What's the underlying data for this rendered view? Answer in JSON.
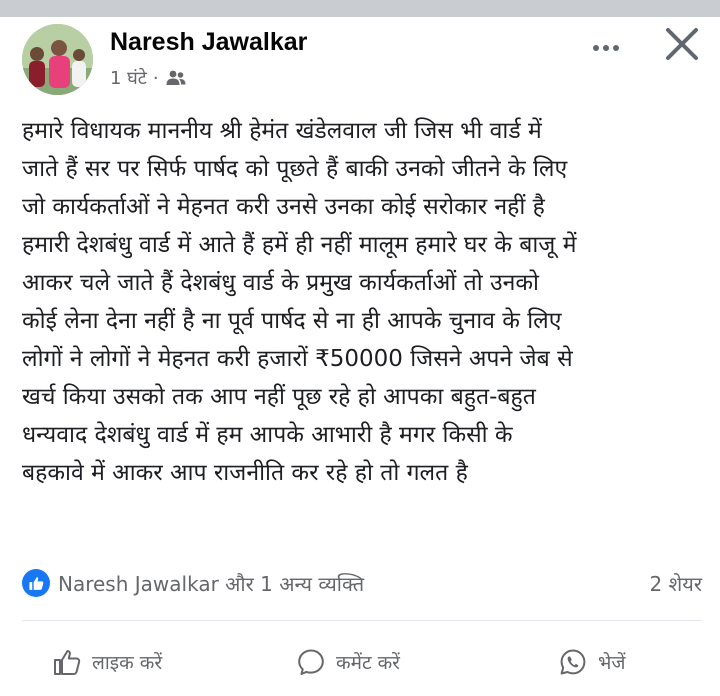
{
  "post": {
    "author": "Naresh Jawalkar",
    "time": "1 घंटे",
    "separator": "·",
    "audience_icon": "friends-icon",
    "more_icon": "more-options-icon",
    "close_icon": "close-icon",
    "lines": [
      "हमारे विधायक माननीय श्री हेमंत खंडेलवाल जी जिस भी वार्ड में",
      "जाते हैं सर पर सिर्फ पार्षद को पूछते हैं बाकी उनको जीतने के लिए",
      "जो कार्यकर्ताओं ने मेहनत करी उनसे उनका कोई सरोकार नहीं है",
      "हमारी देशबंधु वार्ड में आते हैं हमें ही नहीं मालूम हमारे घर के बाजू में",
      "आकर चले जाते हैं देशबंधु वार्ड के प्रमुख कार्यकर्ताओं तो उनको",
      "कोई लेना देना नहीं है ना पूर्व पार्षद से ना ही आपके चुनाव के लिए",
      "लोगों ने लोगों ने मेहनत करी हजारों ₹50000 जिसने अपने जेब से",
      "खर्च किया उसको तक आप नहीं पूछ रहे हो आपका बहुत-बहुत",
      "धन्यवाद देशबंधु वार्ड में हम आपके आभारी है मगर किसी के",
      "बहकावे में आकर आप राजनीति कर रहे हो तो गलत है"
    ]
  },
  "stats": {
    "reactors": "Naresh Jawalkar और 1 अन्य व्यक्ति",
    "shares": "2 शेयर",
    "reaction_color": "#1877f2"
  },
  "actions": {
    "like": "लाइक करें",
    "comment": "कमेंट करें",
    "send": "भेजें"
  },
  "colors": {
    "text": "#1c1e21",
    "secondary": "#65676b",
    "top_bar": "#c9ccd1",
    "background": "#ffffff"
  }
}
